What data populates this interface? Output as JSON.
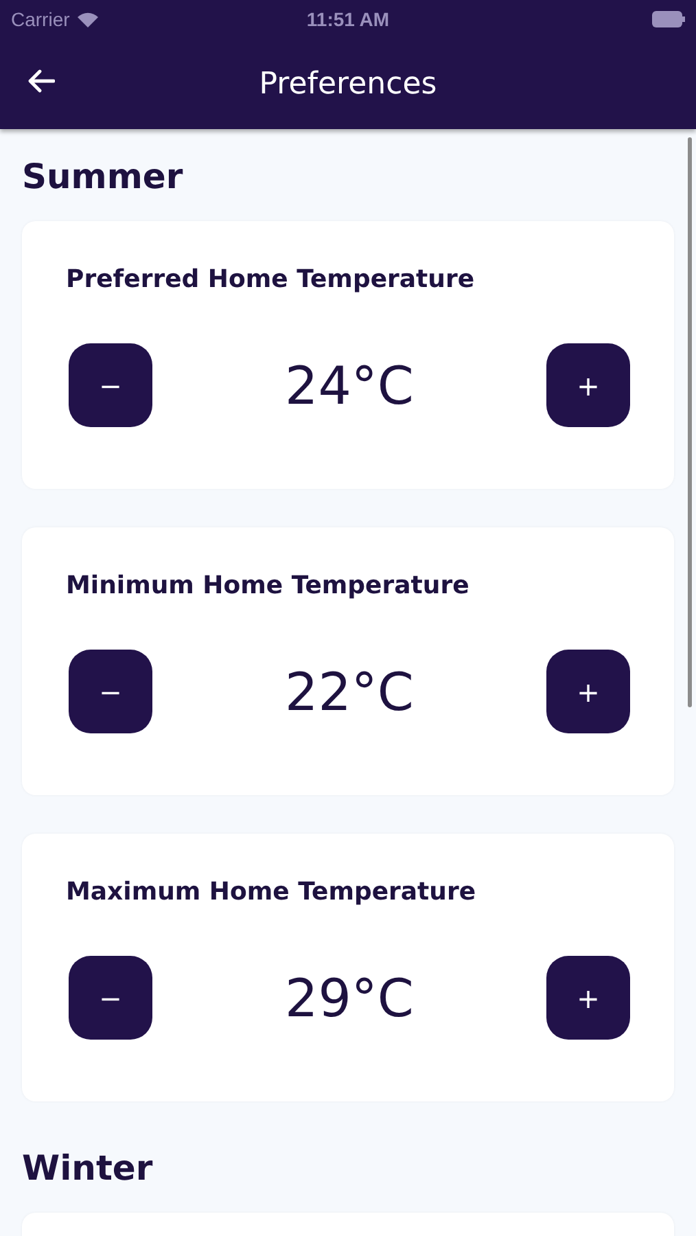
{
  "status_bar": {
    "carrier": "Carrier",
    "time": "11:51 AM"
  },
  "nav": {
    "title": "Preferences"
  },
  "sections": [
    {
      "title": "Summer",
      "cards": [
        {
          "kind": "stepper",
          "label": "Preferred Home Temperature",
          "value": "24°C",
          "decrement": "−",
          "increment": "+"
        },
        {
          "kind": "stepper",
          "label": "Minimum Home Temperature",
          "value": "22°C",
          "decrement": "−",
          "increment": "+"
        },
        {
          "kind": "stepper",
          "label": "Maximum Home Temperature",
          "value": "29°C",
          "decrement": "−",
          "increment": "+"
        }
      ]
    },
    {
      "title": "Winter",
      "cards": [
        {
          "kind": "blank"
        }
      ]
    }
  ]
}
